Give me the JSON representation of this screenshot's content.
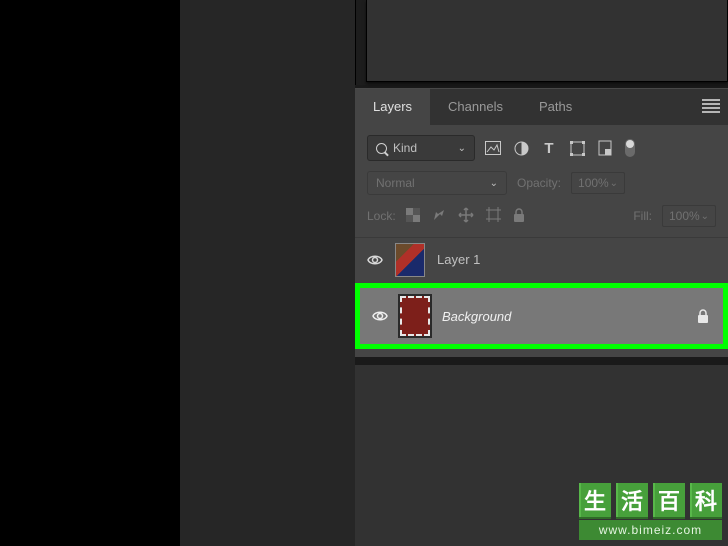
{
  "tabs": {
    "layers": "Layers",
    "channels": "Channels",
    "paths": "Paths"
  },
  "filter": {
    "kind_label": "Kind"
  },
  "blend": {
    "mode": "Normal",
    "opacity_label": "Opacity:",
    "opacity_value": "100%"
  },
  "lock": {
    "label": "Lock:",
    "fill_label": "Fill:",
    "fill_value": "100%"
  },
  "layers": [
    {
      "name": "Layer 1",
      "visible": true,
      "locked": false,
      "selected": false,
      "thumb": "layer1"
    },
    {
      "name": "Background",
      "visible": true,
      "locked": true,
      "selected": true,
      "thumb": "bg"
    }
  ],
  "watermark": {
    "chars": [
      "生",
      "活",
      "百",
      "科"
    ],
    "url": "www.bimeiz.com"
  }
}
